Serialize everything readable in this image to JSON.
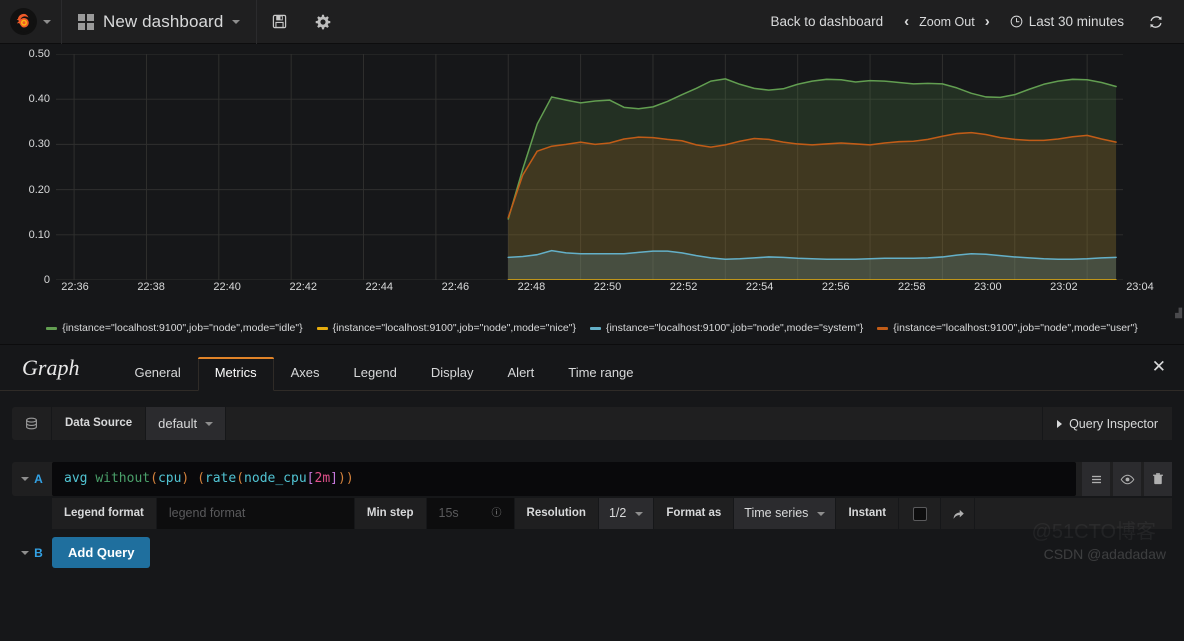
{
  "navbar": {
    "logo_icon": "grafana-logo-icon",
    "grid_icon": "dashboard-grid-icon",
    "dashboard_title": "New dashboard",
    "save_icon": "save-disk-icon",
    "settings_icon": "gear-icon",
    "back_to_dashboard": "Back to dashboard",
    "zoom_out": "Zoom Out",
    "chevron_left": "‹",
    "chevron_right": "›",
    "clock_icon": "clock-icon",
    "time_range": "Last 30 minutes",
    "refresh_icon": "refresh-icon"
  },
  "chart_data": {
    "type": "area",
    "title": "",
    "xlabel": "",
    "ylabel": "",
    "ylim": [
      0,
      0.5
    ],
    "ytick_labels": [
      "0",
      "0.10",
      "0.20",
      "0.30",
      "0.40",
      "0.50"
    ],
    "ytick_values": [
      0,
      0.1,
      0.2,
      0.3,
      0.4,
      0.5
    ],
    "xtick_labels": [
      "22:36",
      "22:38",
      "22:40",
      "22:42",
      "22:44",
      "22:46",
      "22:48",
      "22:50",
      "22:52",
      "22:54",
      "22:56",
      "22:58",
      "23:00",
      "23:02",
      "23:04"
    ],
    "grid": true,
    "legend_position": "bottom",
    "x_start_minutes": 35.5,
    "x_end_minutes": 65.0,
    "data_start_minutes": 48.0,
    "series": [
      {
        "name": "{instance=\"localhost:9100\",job=\"node\",mode=\"idle\"}",
        "color": "#629e51",
        "x": [
          48.0,
          48.4,
          48.8,
          49.2,
          49.6,
          50.0,
          50.4,
          50.8,
          51.2,
          51.6,
          52.0,
          52.4,
          52.8,
          53.2,
          53.6,
          54.0,
          54.4,
          54.8,
          55.2,
          55.6,
          56.0,
          56.4,
          56.8,
          57.2,
          57.6,
          58.0,
          58.4,
          58.8,
          59.2,
          59.6,
          60.0,
          60.4,
          60.8,
          61.2,
          61.6,
          62.0,
          62.4,
          62.8,
          63.2,
          63.6,
          64.0,
          64.4,
          64.8
        ],
        "values": [
          0.135,
          0.245,
          0.345,
          0.405,
          0.398,
          0.392,
          0.396,
          0.398,
          0.382,
          0.379,
          0.383,
          0.395,
          0.41,
          0.424,
          0.44,
          0.445,
          0.433,
          0.424,
          0.42,
          0.423,
          0.433,
          0.44,
          0.444,
          0.443,
          0.438,
          0.441,
          0.44,
          0.437,
          0.434,
          0.435,
          0.434,
          0.425,
          0.413,
          0.405,
          0.404,
          0.41,
          0.422,
          0.433,
          0.44,
          0.444,
          0.443,
          0.437,
          0.428
        ]
      },
      {
        "name": "{instance=\"localhost:9100\",job=\"node\",mode=\"nice\"}",
        "color": "#e5ac0e",
        "x": [
          48.0,
          50.0,
          52.0,
          54.0,
          56.0,
          58.0,
          60.0,
          62.0,
          64.0,
          64.8
        ],
        "values": [
          0.0,
          0.0,
          0.0,
          0.0,
          0.0,
          0.0,
          0.0,
          0.0,
          0.0,
          0.0
        ]
      },
      {
        "name": "{instance=\"localhost:9100\",job=\"node\",mode=\"system\"}",
        "color": "#64b0c8",
        "x": [
          48.0,
          48.4,
          48.8,
          49.2,
          49.6,
          50.0,
          50.4,
          50.8,
          51.2,
          51.6,
          52.0,
          52.4,
          52.8,
          53.2,
          53.6,
          54.0,
          54.4,
          54.8,
          55.2,
          55.6,
          56.0,
          56.4,
          56.8,
          57.2,
          57.6,
          58.0,
          58.4,
          58.8,
          59.2,
          59.6,
          60.0,
          60.4,
          60.8,
          61.2,
          61.6,
          62.0,
          62.4,
          62.8,
          63.2,
          63.6,
          64.0,
          64.4,
          64.8
        ],
        "values": [
          0.05,
          0.052,
          0.056,
          0.065,
          0.06,
          0.058,
          0.058,
          0.058,
          0.058,
          0.061,
          0.064,
          0.064,
          0.06,
          0.054,
          0.049,
          0.046,
          0.047,
          0.049,
          0.051,
          0.05,
          0.048,
          0.047,
          0.046,
          0.046,
          0.046,
          0.047,
          0.048,
          0.048,
          0.048,
          0.049,
          0.051,
          0.055,
          0.058,
          0.057,
          0.054,
          0.051,
          0.049,
          0.047,
          0.046,
          0.046,
          0.047,
          0.049,
          0.05
        ]
      },
      {
        "name": "{instance=\"localhost:9100\",job=\"node\",mode=\"user\"}",
        "color": "#c15c17",
        "x": [
          48.0,
          48.4,
          48.8,
          49.2,
          49.6,
          50.0,
          50.4,
          50.8,
          51.2,
          51.6,
          52.0,
          52.4,
          52.8,
          53.2,
          53.6,
          54.0,
          54.4,
          54.8,
          55.2,
          55.6,
          56.0,
          56.4,
          56.8,
          57.2,
          57.6,
          58.0,
          58.4,
          58.8,
          59.2,
          59.6,
          60.0,
          60.4,
          60.8,
          61.2,
          61.6,
          62.0,
          62.4,
          62.8,
          63.2,
          63.6,
          64.0,
          64.4,
          64.8
        ],
        "values": [
          0.138,
          0.232,
          0.285,
          0.296,
          0.3,
          0.305,
          0.3,
          0.303,
          0.312,
          0.316,
          0.315,
          0.311,
          0.308,
          0.299,
          0.294,
          0.299,
          0.307,
          0.313,
          0.311,
          0.305,
          0.301,
          0.299,
          0.301,
          0.303,
          0.301,
          0.299,
          0.303,
          0.306,
          0.307,
          0.311,
          0.318,
          0.324,
          0.326,
          0.322,
          0.315,
          0.311,
          0.309,
          0.309,
          0.312,
          0.317,
          0.32,
          0.312,
          0.305
        ]
      }
    ]
  },
  "editor": {
    "panel_type": "Graph",
    "tabs": [
      {
        "label": "General",
        "active": false
      },
      {
        "label": "Metrics",
        "active": true
      },
      {
        "label": "Axes",
        "active": false
      },
      {
        "label": "Legend",
        "active": false
      },
      {
        "label": "Display",
        "active": false
      },
      {
        "label": "Alert",
        "active": false
      },
      {
        "label": "Time range",
        "active": false
      }
    ],
    "close_icon": "close-icon",
    "datasource": {
      "db_icon": "database-icon",
      "label": "Data Source",
      "value": "default"
    },
    "query_inspector": "Query Inspector",
    "queries": [
      {
        "ref_id": "A",
        "expression_tokens": [
          {
            "t": "avg",
            "c": "fn"
          },
          {
            "t": " ",
            "c": "plain"
          },
          {
            "t": "without",
            "c": "kw"
          },
          {
            "t": "(",
            "c": "paren"
          },
          {
            "t": "cpu",
            "c": "fn"
          },
          {
            "t": ")",
            "c": "paren"
          },
          {
            "t": " ",
            "c": "plain"
          },
          {
            "t": "(",
            "c": "paren"
          },
          {
            "t": "rate",
            "c": "fn"
          },
          {
            "t": "(",
            "c": "paren"
          },
          {
            "t": "node_cpu",
            "c": "fn"
          },
          {
            "t": "[",
            "c": "br"
          },
          {
            "t": "2m",
            "c": "dur"
          },
          {
            "t": "]",
            "c": "br"
          },
          {
            "t": ")",
            "c": "paren"
          },
          {
            "t": ")",
            "c": "paren"
          }
        ],
        "expression_text": "avg without(cpu) (rate(node_cpu[2m]))",
        "actions": [
          {
            "icon": "list-lines-icon"
          },
          {
            "icon": "eye-icon"
          },
          {
            "icon": "trash-icon"
          }
        ],
        "options": {
          "legend_format_label": "Legend format",
          "legend_format_placeholder": "legend format",
          "legend_format_value": "",
          "min_step_label": "Min step",
          "min_step_placeholder": "15s",
          "min_step_value": "",
          "info_icon": "info-icon",
          "resolution_label": "Resolution",
          "resolution_value": "1/2",
          "format_as_label": "Format as",
          "format_as_value": "Time series",
          "instant_label": "Instant",
          "instant_checked": false,
          "external_link_icon": "external-link-icon"
        }
      },
      {
        "ref_id": "B",
        "add_query_label": "Add Query"
      }
    ]
  },
  "watermark": {
    "line1": "@51CTO博客",
    "line2": "CSDN @adadadaw"
  }
}
